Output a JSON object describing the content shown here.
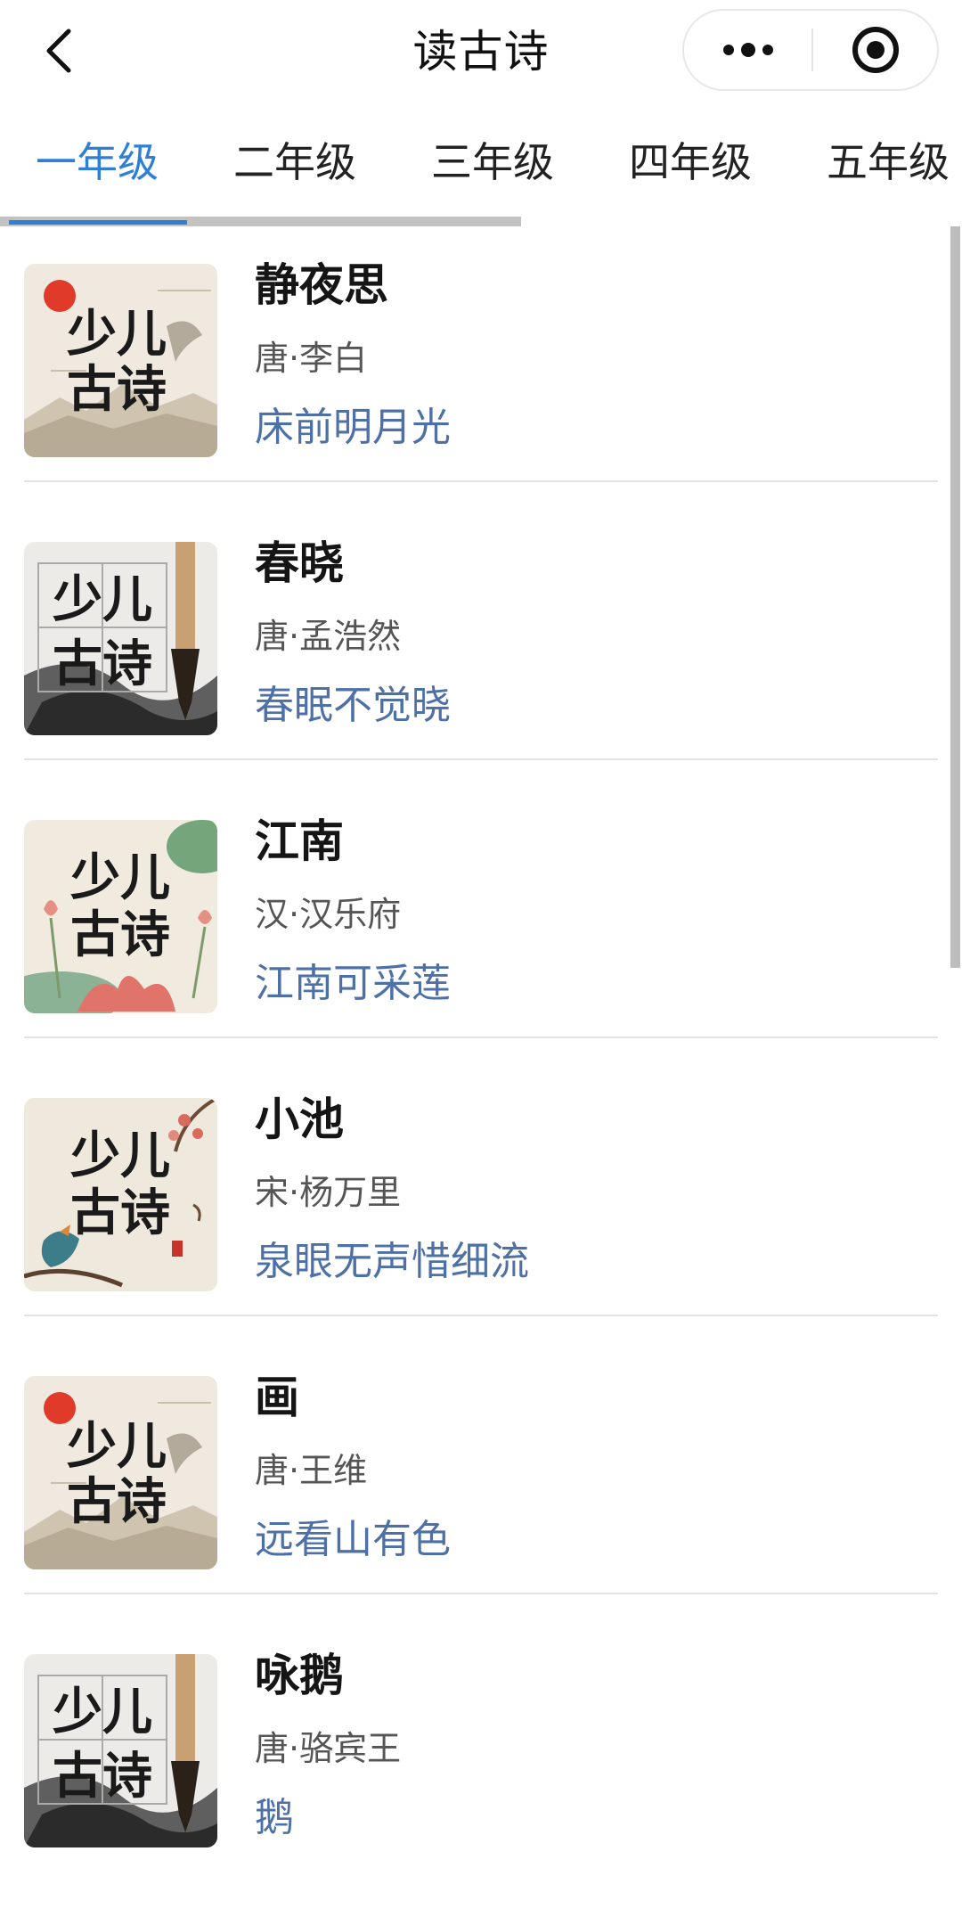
{
  "header": {
    "title": "读古诗",
    "back_icon": "chevron-left-icon",
    "more_icon": "more-dots-icon",
    "close_icon": "target-circle-icon"
  },
  "tabs": [
    {
      "label": "一年级",
      "active": true
    },
    {
      "label": "二年级",
      "active": false
    },
    {
      "label": "三年级",
      "active": false
    },
    {
      "label": "四年级",
      "active": false
    },
    {
      "label": "五年级",
      "active": false
    }
  ],
  "thumbnail_text": {
    "line1": "少儿",
    "line2": "古诗"
  },
  "poems": [
    {
      "title": "静夜思",
      "author": "唐·李白",
      "line": "床前明月光",
      "thumb_style": "sun-crane"
    },
    {
      "title": "春晓",
      "author": "唐·孟浩然",
      "line": "春眠不觉晓",
      "thumb_style": "brush-grid"
    },
    {
      "title": "江南",
      "author": "汉·汉乐府",
      "line": "江南可采莲",
      "thumb_style": "lotus"
    },
    {
      "title": "小池",
      "author": "宋·杨万里",
      "line": "泉眼无声惜细流",
      "thumb_style": "bird-blossom"
    },
    {
      "title": "画",
      "author": "唐·王维",
      "line": "远看山有色",
      "thumb_style": "sun-crane"
    },
    {
      "title": "咏鹅",
      "author": "唐·骆宾王",
      "line": "鹅",
      "thumb_style": "brush-grid"
    }
  ],
  "colors": {
    "accent": "#2f7fd6",
    "poem_line": "#4d70a6",
    "divider": "#e2e2e2"
  }
}
